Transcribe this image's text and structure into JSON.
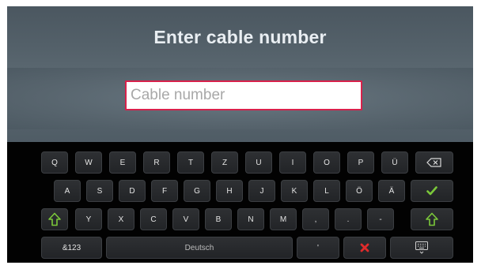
{
  "dialog": {
    "title": "Enter cable number",
    "input_placeholder": "Cable number",
    "input_value": ""
  },
  "keyboard": {
    "row1": [
      "Q",
      "W",
      "E",
      "R",
      "T",
      "Z",
      "U",
      "I",
      "O",
      "P",
      "Ü"
    ],
    "row2": [
      "A",
      "S",
      "D",
      "F",
      "G",
      "H",
      "J",
      "K",
      "L",
      "Ö",
      "Ä"
    ],
    "row3": [
      "Y",
      "X",
      "C",
      "V",
      "B",
      "N",
      "M",
      ",",
      ".",
      "-"
    ],
    "symbols_label": "&123",
    "space_label": "Deutsch",
    "apostrophe_label": "'",
    "icons": {
      "backspace": "backspace-icon",
      "confirm": "checkmark-icon",
      "shift": "shift-arrow-icon",
      "cancel": "cross-icon",
      "hide_keyboard": "keyboard-hide-icon"
    },
    "colors": {
      "confirm": "#7bc83a",
      "shift": "#7bc83a",
      "cancel": "#e02b2b",
      "input_border": "#d8214b"
    }
  }
}
